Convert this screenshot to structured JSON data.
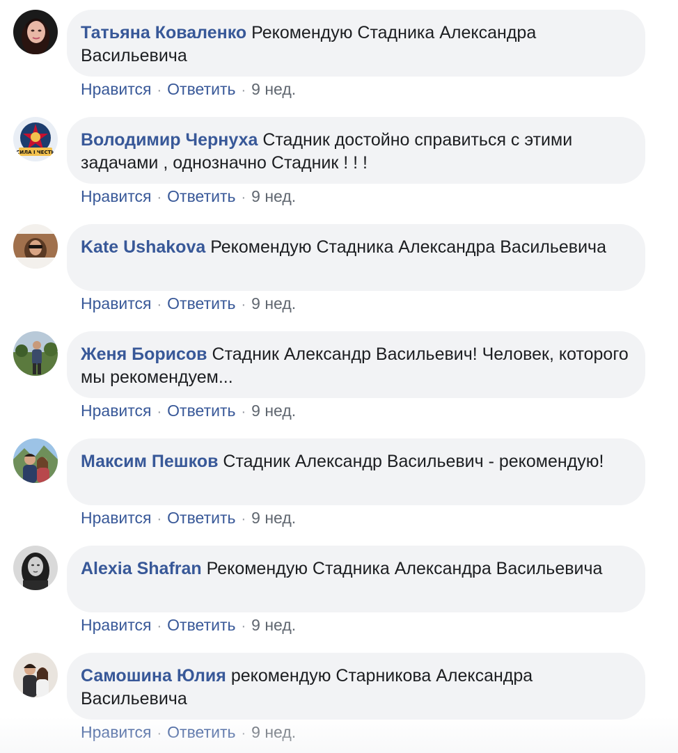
{
  "comments": [
    {
      "author": "Татьяна Коваленко",
      "text": "Рекомендую Стадника Александра Васильевича",
      "like": "Нравится",
      "reply": "Ответить",
      "time": "9 нед.",
      "avatar": "woman-portrait-avatar"
    },
    {
      "author": "Володимир Чернуха",
      "text": "Стадник достойно справиться с этими задачами , однозначно Стадник ! ! !",
      "like": "Нравится",
      "reply": "Ответить",
      "time": "9 нед.",
      "avatar": "emblem-badge-avatar",
      "avatar_caption": "СИЛА І ЧЕСТЬ"
    },
    {
      "author": "Kate Ushakova",
      "text": "Рекомендую Стадника Александра Васильевича",
      "like": "Нравится",
      "reply": "Ответить",
      "time": "9 нед.",
      "avatar": "woman-sunglasses-avatar"
    },
    {
      "author": "Женя Борисов",
      "text": "Стадник Александр Васильевич! Человек, которого мы рекомендуем...",
      "like": "Нравится",
      "reply": "Ответить",
      "time": "9 нед.",
      "avatar": "man-outdoors-avatar"
    },
    {
      "author": "Максим Пешков",
      "text": "Стадник Александр Васильевич - рекомендую!",
      "like": "Нравится",
      "reply": "Ответить",
      "time": "9 нед.",
      "avatar": "couple-mountains-avatar"
    },
    {
      "author": "Alexia Shafran",
      "text": "Рекомендую Стадника Александра Васильевича",
      "like": "Нравится",
      "reply": "Ответить",
      "time": "9 нед.",
      "avatar": "woman-bw-portrait-avatar"
    },
    {
      "author": "Самошина Юлия",
      "text": "рекомендую Старникова Александра Васильевича",
      "like": "Нравится",
      "reply": "Ответить",
      "time": "9 нед.",
      "avatar": "couple-indoor-avatar"
    }
  ],
  "separator": "·",
  "colors": {
    "author": "#385898",
    "bubble": "#f2f3f5",
    "text": "#1c1e21",
    "meta": "#606770"
  }
}
